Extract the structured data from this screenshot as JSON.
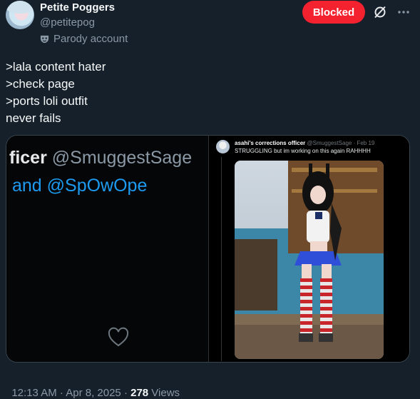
{
  "author": {
    "display_name": "Petite Poggers",
    "handle": "@petitepog",
    "label": "Parody account"
  },
  "actions": {
    "blocked_label": "Blocked",
    "grok_icon": "grok-icon",
    "more_icon": "more-icon"
  },
  "tweet": {
    "text": ">lala content hater\n>check page\n>ports loli outfit\nnever fails"
  },
  "media": {
    "left": {
      "line1_name": "ficer",
      "line1_handle": "@SmuggestSage",
      "line2": "and @SpOwOpe"
    },
    "right": {
      "quote_name": "asahi's corrections officer",
      "quote_handle": "@SmuggestSage · Feb 19",
      "quote_text": "STRUGGLING but im working on this again RAHHHH"
    }
  },
  "meta": {
    "time": "12:13 AM · Apr 8, 2025 · ",
    "views_count": "278",
    "views_label": " Views"
  },
  "colors": {
    "background": "#15202b",
    "blocked": "#f4212e",
    "link": "#1d9bf0",
    "muted": "#8b98a5"
  }
}
